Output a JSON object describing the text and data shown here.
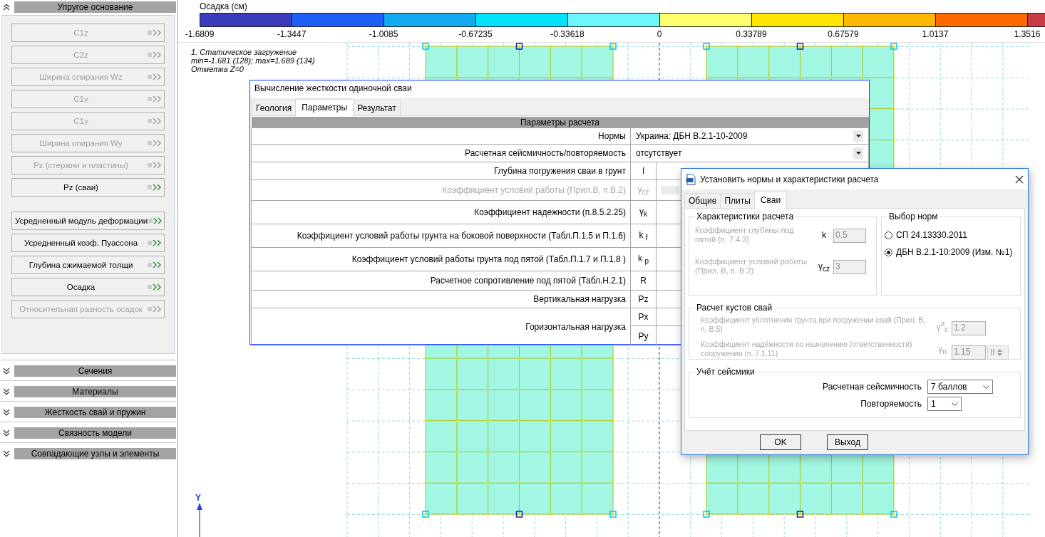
{
  "side_panel": {
    "header": {
      "label": "Упругое основание",
      "expanded": true
    },
    "button_groups": [
      {
        "buttons": [
          {
            "label": "C1z",
            "disabled": true
          },
          {
            "label": "C2z",
            "disabled": true
          },
          {
            "label": "Ширина опирания Wz",
            "disabled": true
          },
          {
            "label": "C1y",
            "disabled": true
          },
          {
            "label": "C1y",
            "disabled": true
          },
          {
            "label": "Ширина опирания Wy",
            "disabled": true
          },
          {
            "label": "Pz (стержни и пластины)",
            "disabled": true
          },
          {
            "label": "Pz (сваи)",
            "disabled": false
          }
        ]
      },
      {
        "buttons": [
          {
            "label": "Усредненный модуль деформации",
            "disabled": false
          },
          {
            "label": "Усредненный коэф. Пуассона",
            "disabled": false
          },
          {
            "label": "Глубина сжимаемой толщи",
            "disabled": false
          },
          {
            "label": "Осадка",
            "disabled": false
          },
          {
            "label": "Относительная разность осадок",
            "disabled": true
          }
        ]
      }
    ],
    "sections": [
      {
        "label": "Сечения",
        "expanded": false
      },
      {
        "label": "Материалы",
        "expanded": false
      },
      {
        "label": "Жесткость свай и пружин",
        "expanded": false
      },
      {
        "label": "Связность модели",
        "expanded": false
      },
      {
        "label": "Совпадающие узлы и элементы",
        "expanded": false
      }
    ]
  },
  "color_scale": {
    "title": "Осадка (см)",
    "bands": [
      {
        "color": "#3b3bbd"
      },
      {
        "color": "#1f5ff5"
      },
      {
        "color": "#12aaf0"
      },
      {
        "color": "#00e4ff"
      },
      {
        "color": "#6ef6ff"
      },
      {
        "color": "#ffff6e"
      },
      {
        "color": "#ffe600"
      },
      {
        "color": "#ffb800"
      },
      {
        "color": "#ff6a00"
      },
      {
        "color": "#c83c46"
      }
    ],
    "ticks": [
      "-1.6809",
      "-1.3447",
      "-1.0085",
      "-0.67235",
      "-0.33618",
      "0",
      "0.33789",
      "0.67579",
      "1.0137",
      "1.3516"
    ]
  },
  "load_info": [
    "1. Статическое загружение",
    "min=-1.681 (128); max=1.689 (134)",
    "Отметка Z=0"
  ],
  "canvas": {
    "axis_label": "Y"
  },
  "pile_dialog": {
    "title": "Вычисление жесткости одиночной сваи",
    "tabs": [
      {
        "label": "Геология",
        "selected": false
      },
      {
        "label": "Параметры",
        "selected": true
      },
      {
        "label": "Результат",
        "selected": false
      }
    ],
    "table_header": "Параметры расчета",
    "rows": [
      {
        "kind": "dropdown",
        "label": "Нормы",
        "value": "Украина: ДБН В.2.1-10-2009",
        "disabled": false
      },
      {
        "kind": "dropdown",
        "label": "Расчетная сейсмичность/повторяемость",
        "value": "отсутствует",
        "disabled": false
      },
      {
        "kind": "symbol",
        "label": "Глубина погружения сваи в грунт",
        "symbol": "l",
        "disabled": false
      },
      {
        "kind": "symbol",
        "label": "Коэффициент условий работы (Прил.В, п.В.2)",
        "symbol": "γ$_{cz}$",
        "disabled": true
      },
      {
        "kind": "symbol",
        "label": "Коэффициент надежности  (п.8.5.2.25)",
        "symbol": "γ$_{k}$",
        "disabled": false
      },
      {
        "kind": "symbol",
        "label": "Коэффициент условий работы грунта на боковой поверхности (Табл.П.1.5 и П.1.6)",
        "symbol": "k $_{f}$",
        "disabled": false
      },
      {
        "kind": "symbol",
        "label": "Коэффициент условий работы грунта под пятой (Табл.П.1.7 и П.1.8 )",
        "symbol": "k $_{p}$",
        "disabled": false
      },
      {
        "kind": "symbol",
        "label": "Расчетное сопротивление под пятой (Табл.Н.2.1)",
        "symbol": "R",
        "disabled": false
      },
      {
        "kind": "symbol",
        "label": "Вертикальная нагрузка",
        "symbol": "Pz",
        "disabled": false
      },
      {
        "kind": "pair",
        "label": "Горизонтальная нагрузка",
        "symbols": [
          "Px",
          "Py"
        ],
        "disabled": false
      }
    ]
  },
  "norms_dialog": {
    "title": "Установить нормы и характеристики расчета",
    "tabs": [
      {
        "label": "Общие",
        "selected": false
      },
      {
        "label": "Плиты",
        "selected": false
      },
      {
        "label": "Сваи",
        "selected": true
      }
    ],
    "calc_group": {
      "title": "Характеристики расчета",
      "rows": [
        {
          "label": "Коэффициент глубины под пятой (п. 7.4.3)",
          "symbol": "k",
          "value": "0.5",
          "disabled": true
        },
        {
          "label": "Коэффициент условий работы (Прил. В, п. В.2)",
          "symbol": "γ$_{cz}$",
          "value": "3",
          "disabled": true
        }
      ]
    },
    "norms_group": {
      "title": "Выбор норм",
      "options": [
        {
          "label": "СП 24.13330.2011",
          "selected": false
        },
        {
          "label": "ДБН В.2.1-10:2009 (Изм. №1)",
          "selected": true
        }
      ]
    },
    "cluster_group": {
      "title": "Расчет кустов свай",
      "rows": [
        {
          "kind": "field",
          "label": "Коэффициент уплотнения грунта при погружении свай (Прил. В, п. В.5)",
          "symbol": "γ$^{a}$$_{c}$",
          "value": "1.2",
          "disabled": true
        },
        {
          "kind": "spinner",
          "label": "Коэффициент надёжности по назначению (ответственности) сооружения (п. 7.1.11)",
          "symbol": "γ$_{n}$",
          "value": "1.15",
          "grade": "II",
          "disabled": true
        }
      ]
    },
    "seismic_group": {
      "title": "Учёт сейсмики",
      "rows": [
        {
          "label": "Расчетная сейсмичность",
          "value": "7 баллов"
        },
        {
          "label": "Повторяемость",
          "value": "1"
        }
      ]
    },
    "buttons": [
      {
        "label": "OK"
      },
      {
        "label": "Выход"
      }
    ]
  }
}
